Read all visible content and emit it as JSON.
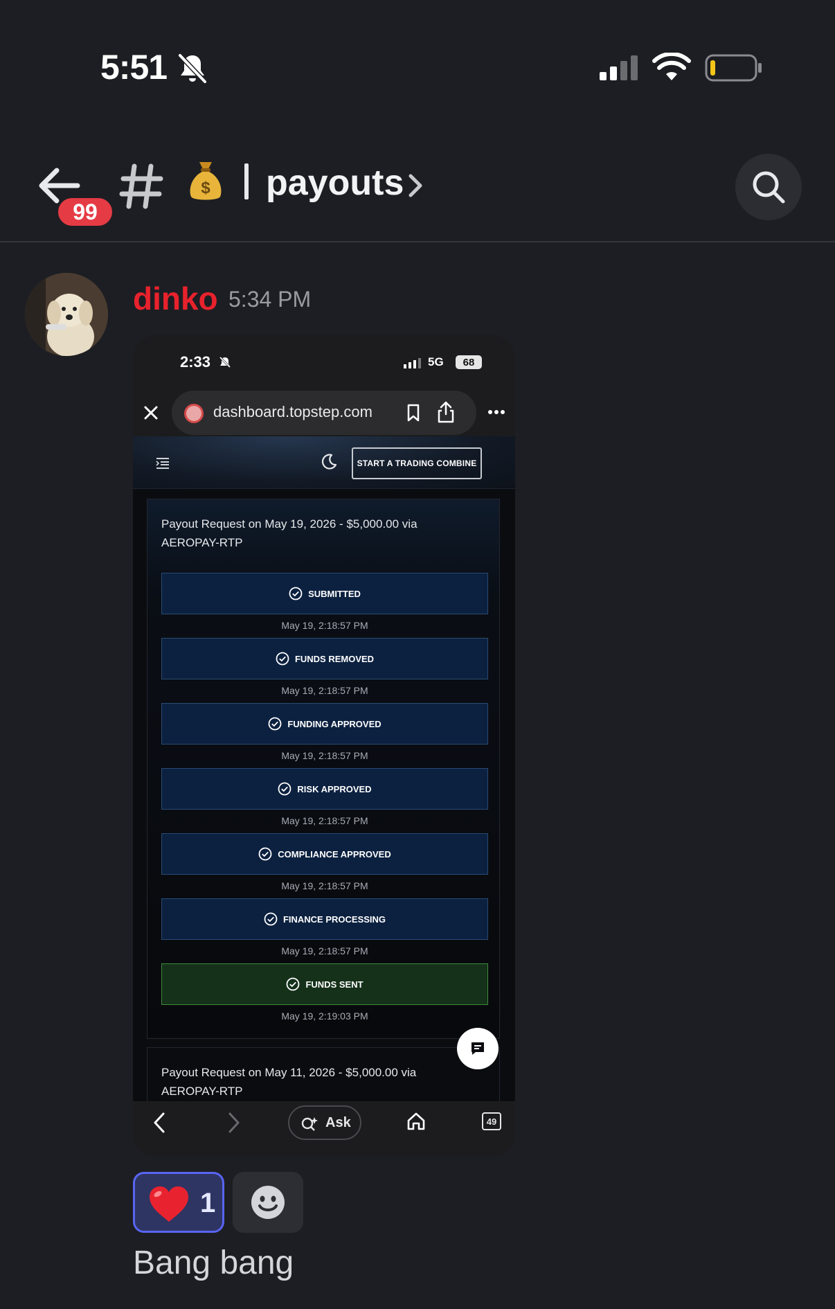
{
  "status_bar": {
    "time": "5:51"
  },
  "header": {
    "unread_badge": "99",
    "channel_name": "payouts"
  },
  "message": {
    "author": "dinko",
    "timestamp": "5:34 PM",
    "text": "Bang bang",
    "reactions": [
      {
        "emoji": "heart",
        "count": "1"
      }
    ]
  },
  "attachment": {
    "status": {
      "time": "2:33",
      "network": "5G",
      "battery": "68"
    },
    "browser": {
      "url": "dashboard.topstep.com",
      "tabs_count": "49",
      "ask_label": "Ask"
    },
    "page": {
      "cta_label": "START A TRADING COMBINE",
      "payouts": [
        {
          "title": "Payout Request on May 19, 2026 - $5,000.00 via AEROPAY-RTP",
          "steps": [
            {
              "label": "SUBMITTED",
              "time": "May 19, 2:18:57 PM"
            },
            {
              "label": "FUNDS REMOVED",
              "time": "May 19, 2:18:57 PM"
            },
            {
              "label": "FUNDING APPROVED",
              "time": "May 19, 2:18:57 PM"
            },
            {
              "label": "RISK APPROVED",
              "time": "May 19, 2:18:57 PM"
            },
            {
              "label": "COMPLIANCE APPROVED",
              "time": "May 19, 2:18:57 PM"
            },
            {
              "label": "FINANCE PROCESSING",
              "time": "May 19, 2:18:57 PM"
            },
            {
              "label": "FUNDS SENT",
              "time": "May 19, 2:19:03 PM"
            }
          ]
        },
        {
          "title": "Payout Request on May 11, 2026 - $5,000.00 via AEROPAY-RTP"
        }
      ]
    }
  },
  "colors": {
    "background": "#1d1e23",
    "author": "#e8222d",
    "badge": "#e53b45",
    "reaction_border": "#5965f2",
    "step_bg": "#0c2140",
    "step_sent_bg": "#15311a"
  }
}
